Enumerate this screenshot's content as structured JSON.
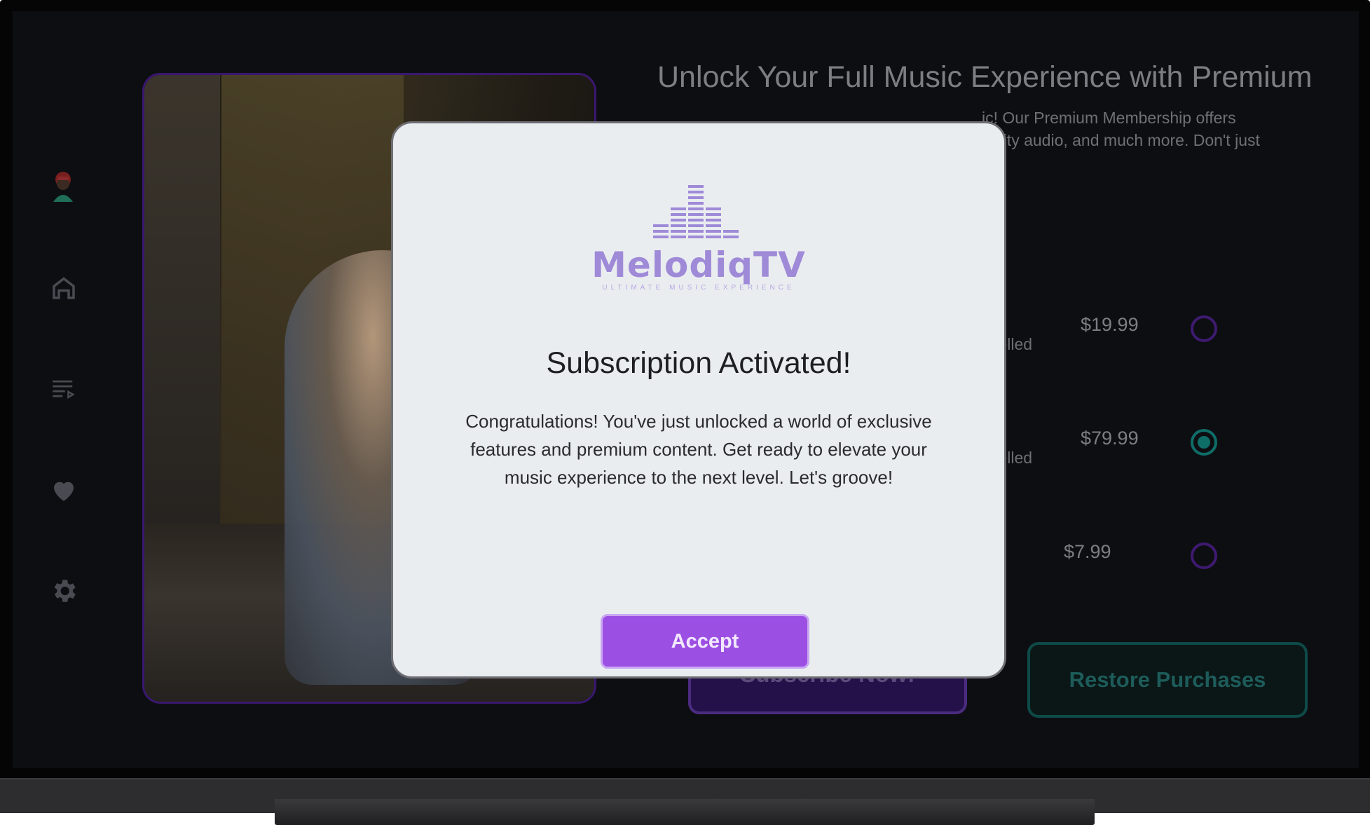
{
  "sidebar": {
    "items": [
      {
        "name": "avatar"
      },
      {
        "name": "home"
      },
      {
        "name": "playlist"
      },
      {
        "name": "favorites"
      },
      {
        "name": "settings"
      }
    ]
  },
  "main": {
    "headline": "Unlock Your Full Music Experience with Premium",
    "subtext_line1": "ic! Our Premium Membership offers",
    "subtext_line2": "uality audio, and much more. Don't just",
    "plans": [
      {
        "desc_fragment": "celled",
        "price": "$19.99",
        "selected": false
      },
      {
        "desc_fragment": "celled",
        "price": "$79.99",
        "selected": true
      },
      {
        "desc_fragment": "",
        "price": "$7.99",
        "selected": false
      }
    ],
    "subscribe_label": "Subscribe Now!",
    "restore_label": "Restore Purchases"
  },
  "modal": {
    "logo_word": "MelodiqTV",
    "logo_tagline": "ULTIMATE MUSIC EXPERIENCE",
    "title": "Subscription Activated!",
    "body": "Congratulations! You've just unlocked a world of exclusive features and premium content. Get ready to elevate your music experience to the next level. Let's groove!",
    "accept_label": "Accept"
  },
  "colors": {
    "accent_purple": "#9c4fe3",
    "teal": "#0f6d68",
    "modal_bg": "#eaedf0",
    "screen_bg": "#0d0e12"
  }
}
